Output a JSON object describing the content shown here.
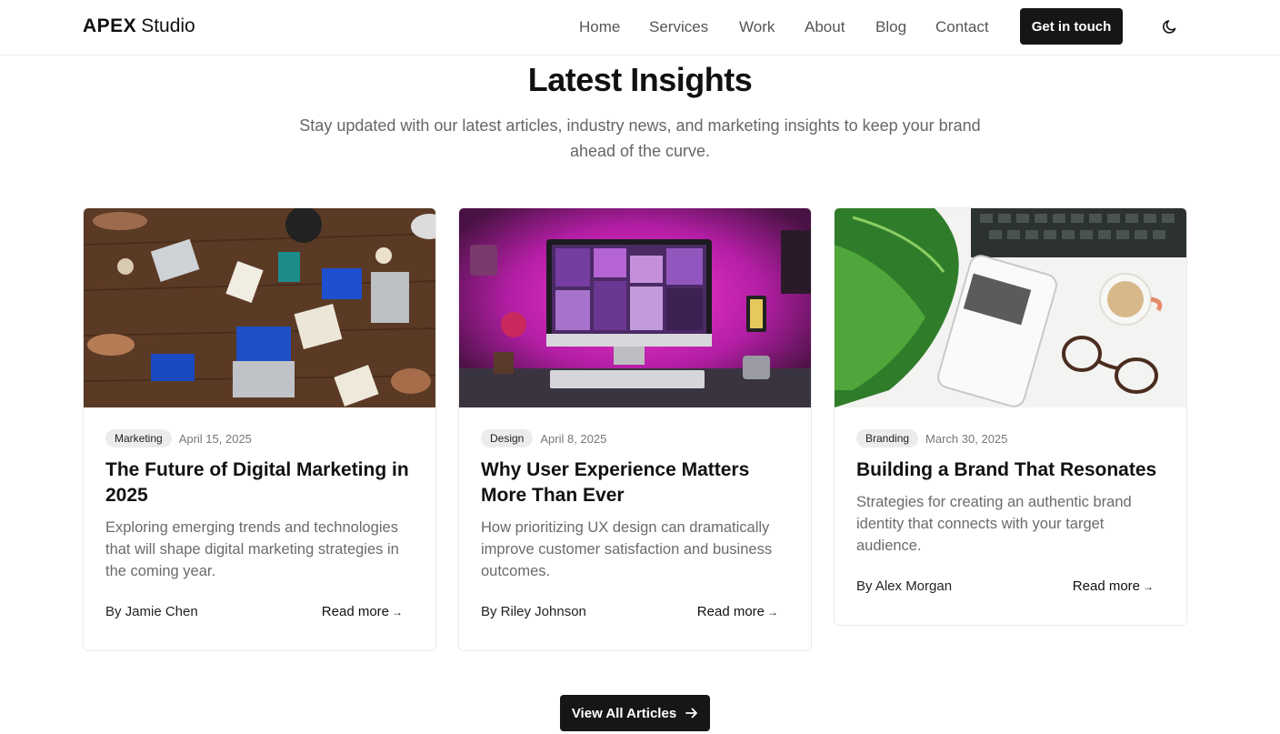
{
  "header": {
    "logo_strong": "APEX",
    "logo_rest": "Studio",
    "nav": [
      "Home",
      "Services",
      "Work",
      "About",
      "Blog",
      "Contact"
    ],
    "cta_label": "Get in touch",
    "theme_icon": "moon-icon"
  },
  "section": {
    "title": "Latest Insights",
    "subtitle": "Stay updated with our latest articles, industry news, and marketing insights to keep your brand ahead of the curve."
  },
  "articles": [
    {
      "tag": "Marketing",
      "date": "April 15, 2025",
      "title": "The Future of Digital Marketing in 2025",
      "description": "Exploring emerging trends and technologies that will shape digital marketing strategies in the coming year.",
      "author": "By Jamie Chen",
      "read_more": "Read more",
      "image": "team-meeting-table-photo"
    },
    {
      "tag": "Design",
      "date": "April 8, 2025",
      "title": "Why User Experience Matters More Than Ever",
      "description": "How prioritizing UX design can dramatically improve customer satisfaction and business outcomes.",
      "author": "By Riley Johnson",
      "read_more": "Read more",
      "image": "desk-computer-pink-light-photo"
    },
    {
      "tag": "Branding",
      "date": "March 30, 2025",
      "title": "Building a Brand That Resonates",
      "description": "Strategies for creating an authentic brand identity that connects with your target audience.",
      "author": "By Alex Morgan",
      "read_more": "Read more",
      "image": "online-marketing-phone-desk-photo"
    }
  ],
  "view_all_label": "View All Articles",
  "colors": {
    "primary": "#161616",
    "muted_text": "#6b6b6b",
    "tag_bg": "#ececec"
  }
}
